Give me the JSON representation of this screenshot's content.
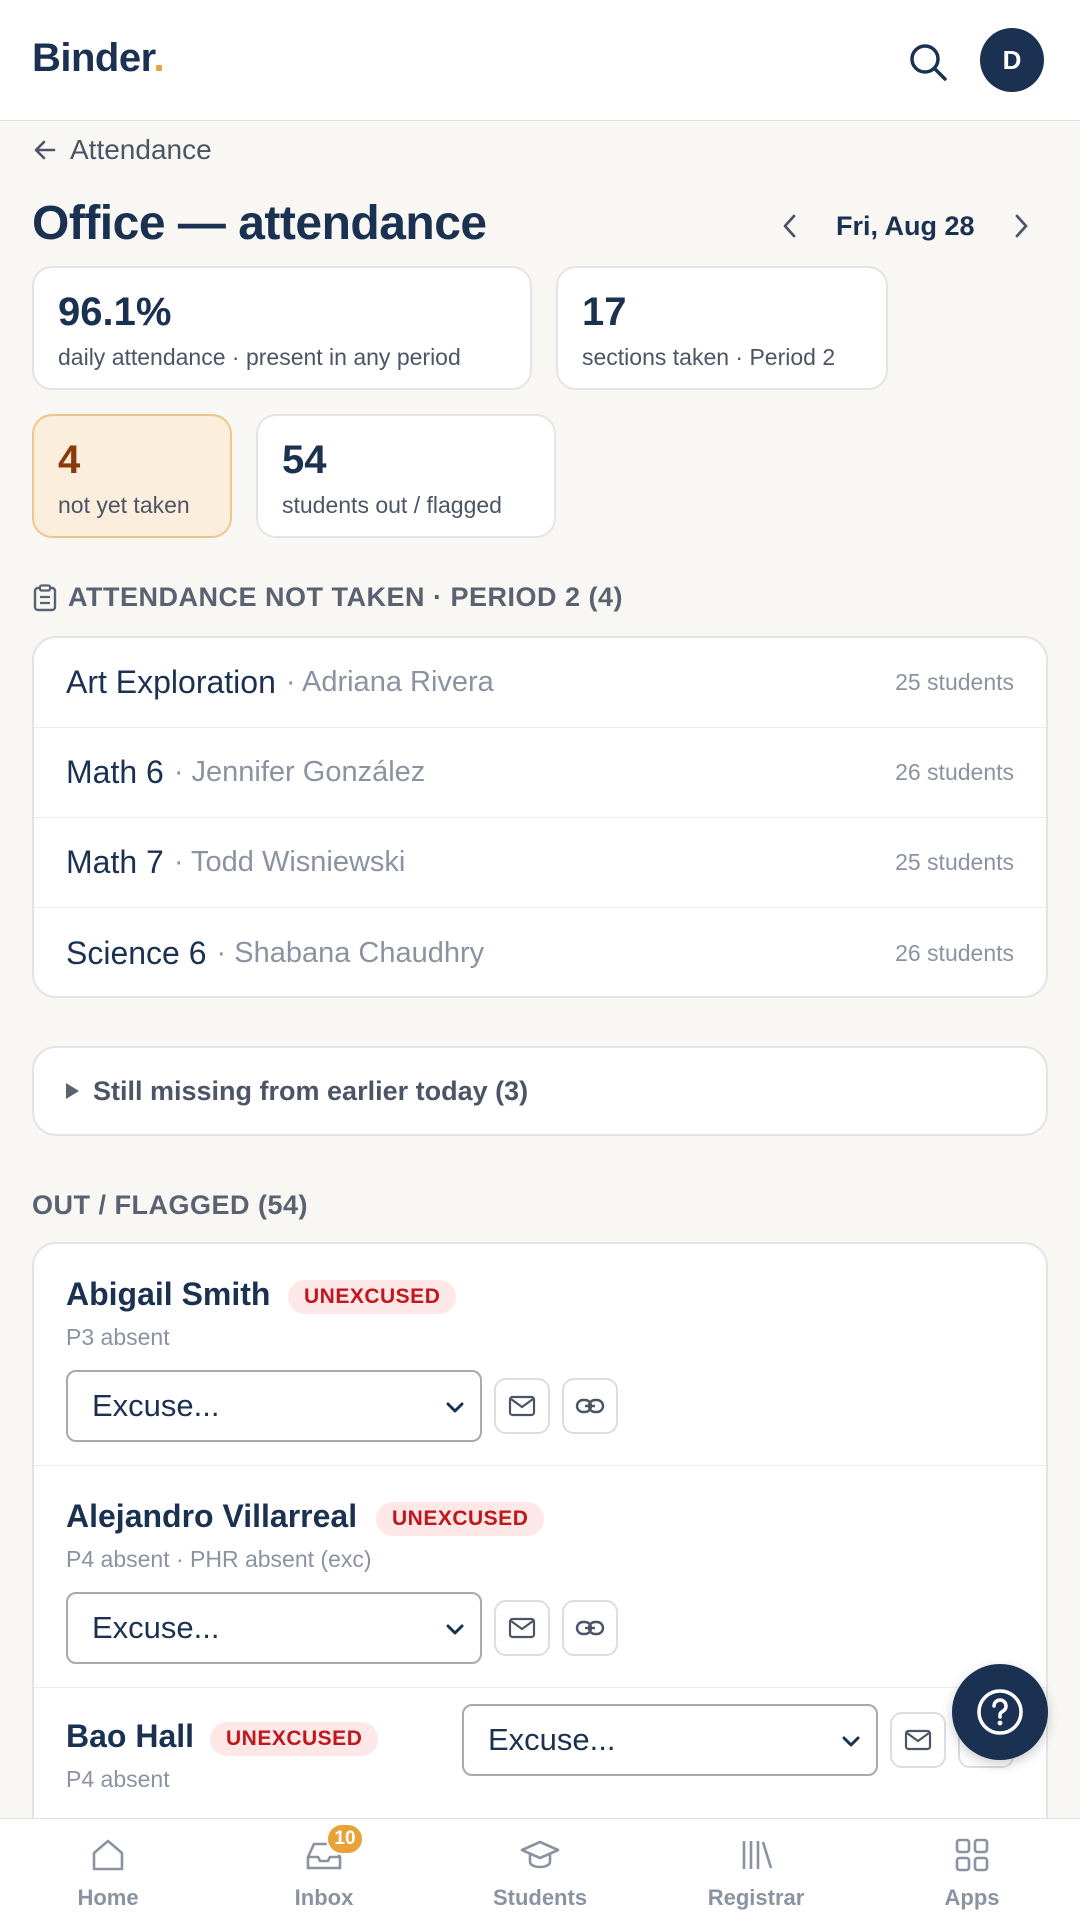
{
  "app": {
    "brand": "Binder",
    "brand_dot": ".",
    "avatar_initial": "D"
  },
  "breadcrumb": {
    "back_label": "Attendance"
  },
  "page": {
    "title": "Office — attendance",
    "date": "Fri, Aug 28"
  },
  "stats": [
    {
      "value": "96.1%",
      "label": "daily attendance · present in any period"
    },
    {
      "value": "17",
      "label": "sections taken · Period 2"
    },
    {
      "value": "4",
      "label": "not yet taken"
    },
    {
      "value": "54",
      "label": "students out / flagged"
    }
  ],
  "not_taken": {
    "heading": "ATTENDANCE NOT TAKEN · PERIOD 2 (4)",
    "rows": [
      {
        "course": "Art Exploration",
        "teacher": "· Adriana Rivera",
        "count": "25 students"
      },
      {
        "course": "Math 6",
        "teacher": "· Jennifer González",
        "count": "26 students"
      },
      {
        "course": "Math 7",
        "teacher": "· Todd Wisniewski",
        "count": "25 students"
      },
      {
        "course": "Science 6",
        "teacher": "· Shabana Chaudhry",
        "count": "26 students"
      }
    ]
  },
  "earlier": {
    "label": "Still missing from earlier today (3)"
  },
  "flagged": {
    "heading": "OUT / FLAGGED (54)",
    "students": [
      {
        "name": "Abigail Smith",
        "badge": "UNEXCUSED",
        "detail": "P3 absent",
        "select_value": "Excuse..."
      },
      {
        "name": "Alejandro Villarreal",
        "badge": "UNEXCUSED",
        "detail": "P4 absent · PHR absent (exc)",
        "select_value": "Excuse..."
      },
      {
        "name": "Bao Hall",
        "badge": "UNEXCUSED",
        "detail": "P4 absent",
        "select_value": "Excuse..."
      }
    ]
  },
  "nav": {
    "items": [
      {
        "label": "Home",
        "icon": "home-icon"
      },
      {
        "label": "Inbox",
        "icon": "inbox-icon",
        "badge": "10"
      },
      {
        "label": "Students",
        "icon": "graduation-cap-icon"
      },
      {
        "label": "Registrar",
        "icon": "library-icon"
      },
      {
        "label": "Apps",
        "icon": "grid-icon"
      }
    ]
  },
  "colors": {
    "navy": "#1b3152",
    "accent": "#e8a23a",
    "danger": "#c0161c",
    "warn_bg": "#fbeedd"
  }
}
